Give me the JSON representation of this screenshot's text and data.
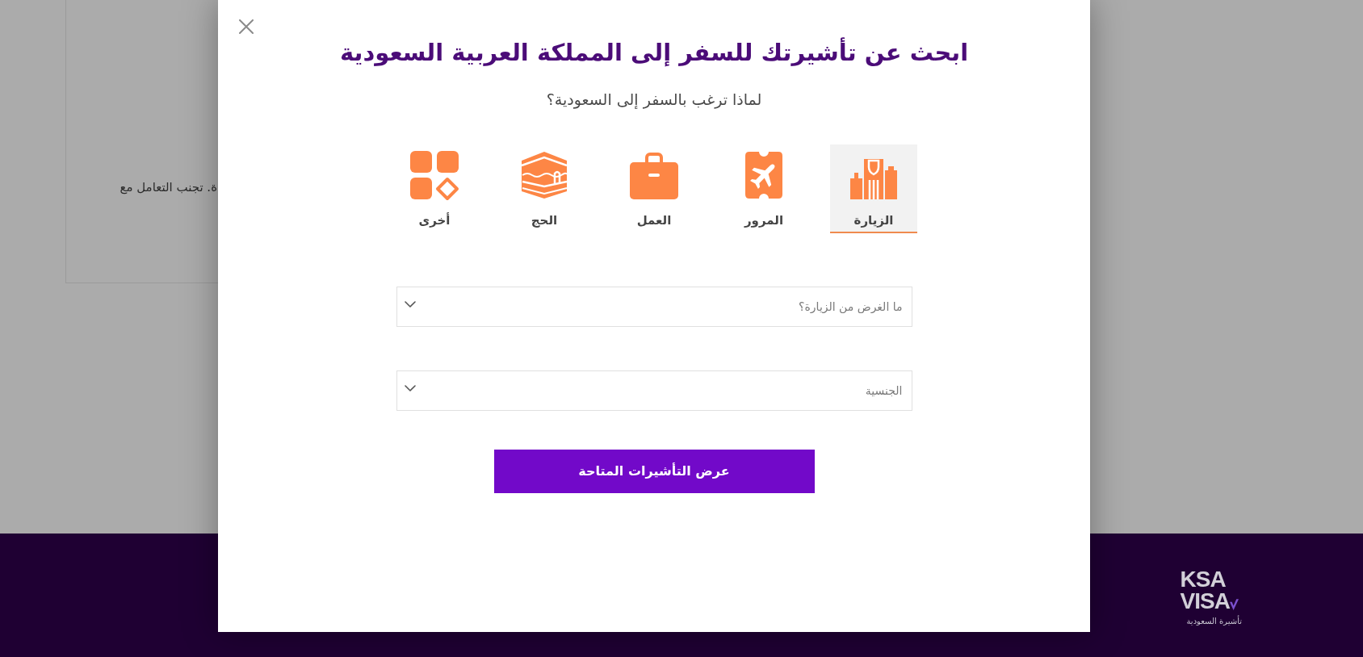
{
  "background_page": {
    "notice_text": "ة. تجنب التعامل مع"
  },
  "footer": {
    "logo": {
      "line_1": "KSA",
      "line_2": "VISA",
      "tagline": "تأشيرة السعودية"
    }
  },
  "modal": {
    "title": "ابحث عن تأشيرتك للسفر إلى المملكة العربية السعودية",
    "subtitle": "لماذا ترغب بالسفر إلى السعودية؟",
    "purposes": [
      {
        "label": "الزيارة",
        "kind": "buildings",
        "selected": true
      },
      {
        "label": "المرور",
        "kind": "ticket",
        "selected": false
      },
      {
        "label": "العمل",
        "kind": "briefcase",
        "selected": false
      },
      {
        "label": "الحج",
        "kind": "kaaba",
        "selected": false
      },
      {
        "label": "أخرى",
        "kind": "shapes",
        "selected": false
      }
    ],
    "fields": [
      {
        "placeholder": "ما الغرض من الزيارة؟"
      },
      {
        "placeholder": "الجنسية"
      }
    ],
    "submit_button": "عرض التأشيرات المتاحة"
  }
}
